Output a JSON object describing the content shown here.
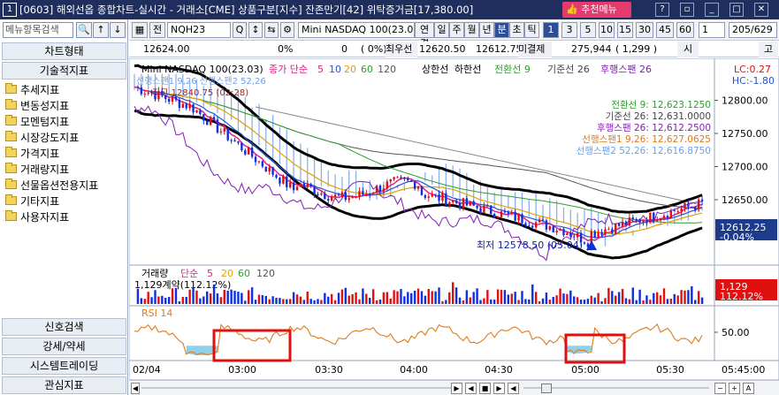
{
  "titlebar": {
    "number": "1",
    "title": "[0603] 해외선옵 종합차트-실시간 - 거래소[CME] 상품구분[지수] 잔존만기[42] 위탁증거금[17,380.00]",
    "recommend_label": "추천메뉴",
    "window_buttons": [
      "?",
      "▫",
      "_",
      "□",
      "✕"
    ]
  },
  "left_panel": {
    "search_placeholder": "메뉴항목검색",
    "search_btn": "🔍",
    "up_btn": "↑",
    "down_btn": "↓",
    "headers": [
      "차트형태",
      "기술적지표"
    ],
    "tree": [
      "추세지표",
      "변동성지표",
      "모멘텀지표",
      "시장강도지표",
      "가격지표",
      "거래량지표",
      "선물옵션전용지표",
      "기타지표",
      "사용자지표"
    ],
    "bottom_headers": [
      "신호검색",
      "강세/약세",
      "시스템트레이딩",
      "관심지표"
    ]
  },
  "toolbar": {
    "icon_btn": "▦",
    "mode": "전",
    "symbol": "NQH23",
    "symbol_name": "Mini NASDAQ 100(23.03)",
    "tabs": [
      "연결",
      "일",
      "주",
      "월",
      "년",
      "분",
      "초",
      "틱"
    ],
    "selected_tab": "분",
    "intervals": [
      "1",
      "3",
      "5",
      "10",
      "15",
      "30",
      "45",
      "60"
    ],
    "selected_interval": "1",
    "count_value": "1",
    "range": "205/629"
  },
  "inforow": {
    "price": "12624.00",
    "change_pct": "0%",
    "vol": "0",
    "vol_pct": "0%",
    "high_label": "최우선",
    "high_a": "12620.50",
    "high_b": "12612.75",
    "open_label": "미결제",
    "open_int": "275,944",
    "open_chg": "( 1,299 )",
    "si_label": "시",
    "go_label": "고"
  },
  "price_chart": {
    "name": "Mini NASDAQ 100(23.03)",
    "ma_label": "종가 단순",
    "ma_periods": [
      "5",
      "10",
      "20",
      "60",
      "120"
    ],
    "upper_band": "상한선",
    "lower_band": "하한선",
    "ichimoku_conv": "전환선 9",
    "ichimoku_base": "기준선 26",
    "ichimoku_lag": "후행스팬 26",
    "lead_span_text": "선행스팬1 9,26 선행스팬2 52,26",
    "high_marker": "최고 12840.75 (02:28)",
    "low_marker": "최저 12578.50 (05:04)",
    "lc": "LC:0.27",
    "hc": "HC:-1.80",
    "legend_values": [
      "전환선 9: 12,623.1250",
      "기준선 26: 12,631.0000",
      "후행스팬 26: 12,612.2500",
      "선행스팬1 9,26: 12,627.0625",
      "선행스팬2 52,26: 12,616.8750"
    ],
    "y_ticks": [
      "12800.00",
      "12750.00",
      "12700.00",
      "12650.00"
    ],
    "current_price": "12612.25",
    "current_pct": "-0.04%"
  },
  "volume_chart": {
    "title": "거래량",
    "ma_label": "단순",
    "periods": [
      "5",
      "20",
      "60",
      "120"
    ],
    "info": "1,129계약(112.12%)",
    "current": "1,129",
    "current_pct": "112.12%"
  },
  "rsi_chart": {
    "title": "RSI 14",
    "tick": "50.00"
  },
  "x_axis": {
    "date": "02/04",
    "times": [
      "03:00",
      "03:30",
      "04:00",
      "04:30",
      "05:00",
      "05:30"
    ],
    "end_time": "05:45:00"
  },
  "colors": {
    "title_bg": "#1f2e5c",
    "ma5": "#e0218a",
    "ma10": "#2455d6",
    "ma20": "#e0a000",
    "ma60": "#2e9e2e",
    "ma120": "#555555",
    "band": "#000000",
    "cloud": "#6fa0e6",
    "rsi": "#e07b1a",
    "highlight": "#e01010"
  },
  "bottom_bar": {
    "controls": [
      "◀",
      "▶",
      "■",
      "▶",
      "◀"
    ],
    "zoom": [
      "−",
      "+",
      "A"
    ]
  }
}
